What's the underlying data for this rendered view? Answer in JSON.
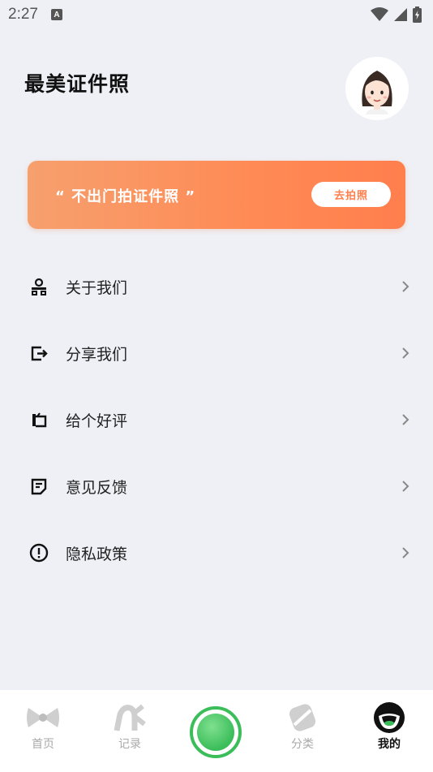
{
  "status": {
    "time": "2:27",
    "badge": "A"
  },
  "header": {
    "title": "最美证件照"
  },
  "banner": {
    "text": "“ 不出门拍证件照 ”",
    "button_label": "去拍照"
  },
  "menu": [
    {
      "label": "关于我们",
      "icon": "users-icon"
    },
    {
      "label": "分享我们",
      "icon": "share-icon"
    },
    {
      "label": "给个好评",
      "icon": "rating-icon"
    },
    {
      "label": "意见反馈",
      "icon": "feedback-icon"
    },
    {
      "label": "隐私政策",
      "icon": "privacy-icon"
    }
  ],
  "tabs": [
    {
      "label": "首页"
    },
    {
      "label": "记录"
    },
    {
      "label": "分类"
    },
    {
      "label": "我的"
    }
  ],
  "colors": {
    "accent": "#ff7f4d",
    "camera": "#3bbd5a",
    "background": "#eff0f5"
  }
}
